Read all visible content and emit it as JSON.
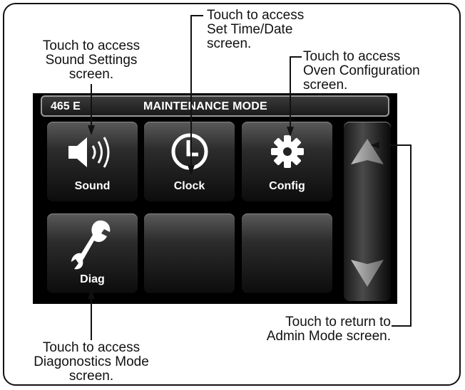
{
  "callouts": {
    "time": [
      "Touch to access",
      "Set Time/Date",
      "screen."
    ],
    "sound": [
      "Touch to access",
      "Sound Settings",
      "screen."
    ],
    "oven": [
      "Touch to access",
      "Oven Configuration",
      "screen."
    ],
    "admin": [
      "Touch to return to",
      "Admin Mode screen."
    ],
    "diag": [
      "Touch to access",
      "Diagonostics Mode",
      "screen."
    ]
  },
  "screen": {
    "model": "465 E",
    "title": "MAINTENANCE MODE",
    "tiles": [
      {
        "label": "Sound",
        "icon": "speaker-icon"
      },
      {
        "label": "Clock",
        "icon": "clock-icon"
      },
      {
        "label": "Config",
        "icon": "gear-icon"
      },
      {
        "label": "Diag",
        "icon": "wrench-icon"
      },
      {
        "label": "",
        "icon": ""
      },
      {
        "label": "",
        "icon": ""
      }
    ],
    "scroll": {
      "up_icon": "scroll-up-arrow-icon",
      "down_icon": "scroll-down-arrow-icon"
    }
  }
}
